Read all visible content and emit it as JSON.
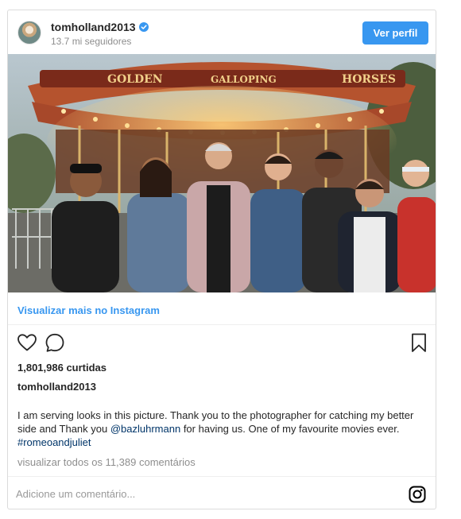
{
  "header": {
    "username": "tomholland2013",
    "followers": "13.7 mi seguidores",
    "view_profile_label": "Ver perfil"
  },
  "view_more_label": "Visualizar mais no Instagram",
  "likes": "1,801,986 curtidas",
  "caption": {
    "username": "tomholland2013",
    "text_part1": "I am serving looks in this picture. Thank you to the photographer for catching my better side and Thank you ",
    "mention": "@bazluhrmann",
    "text_part2": " for having us. One of my favourite movies ever. ",
    "hashtag": "#romeoandjuliet"
  },
  "comments_link": "visualizar todos os 11,389 comentários",
  "comment_input": {
    "placeholder": "Adicione um comentário..."
  },
  "carousel_sign": {
    "left": "GOLDEN",
    "middle": "GALLOPING",
    "right": "HORSES"
  },
  "icons": {
    "verified": "verified-badge-icon",
    "like": "heart-icon",
    "comment": "comment-bubble-icon",
    "save": "bookmark-icon",
    "instagram": "instagram-logo-icon"
  },
  "colors": {
    "accent": "#3897f0",
    "link": "#003569",
    "muted": "#8e8e8e",
    "border": "#dbdbdb"
  }
}
